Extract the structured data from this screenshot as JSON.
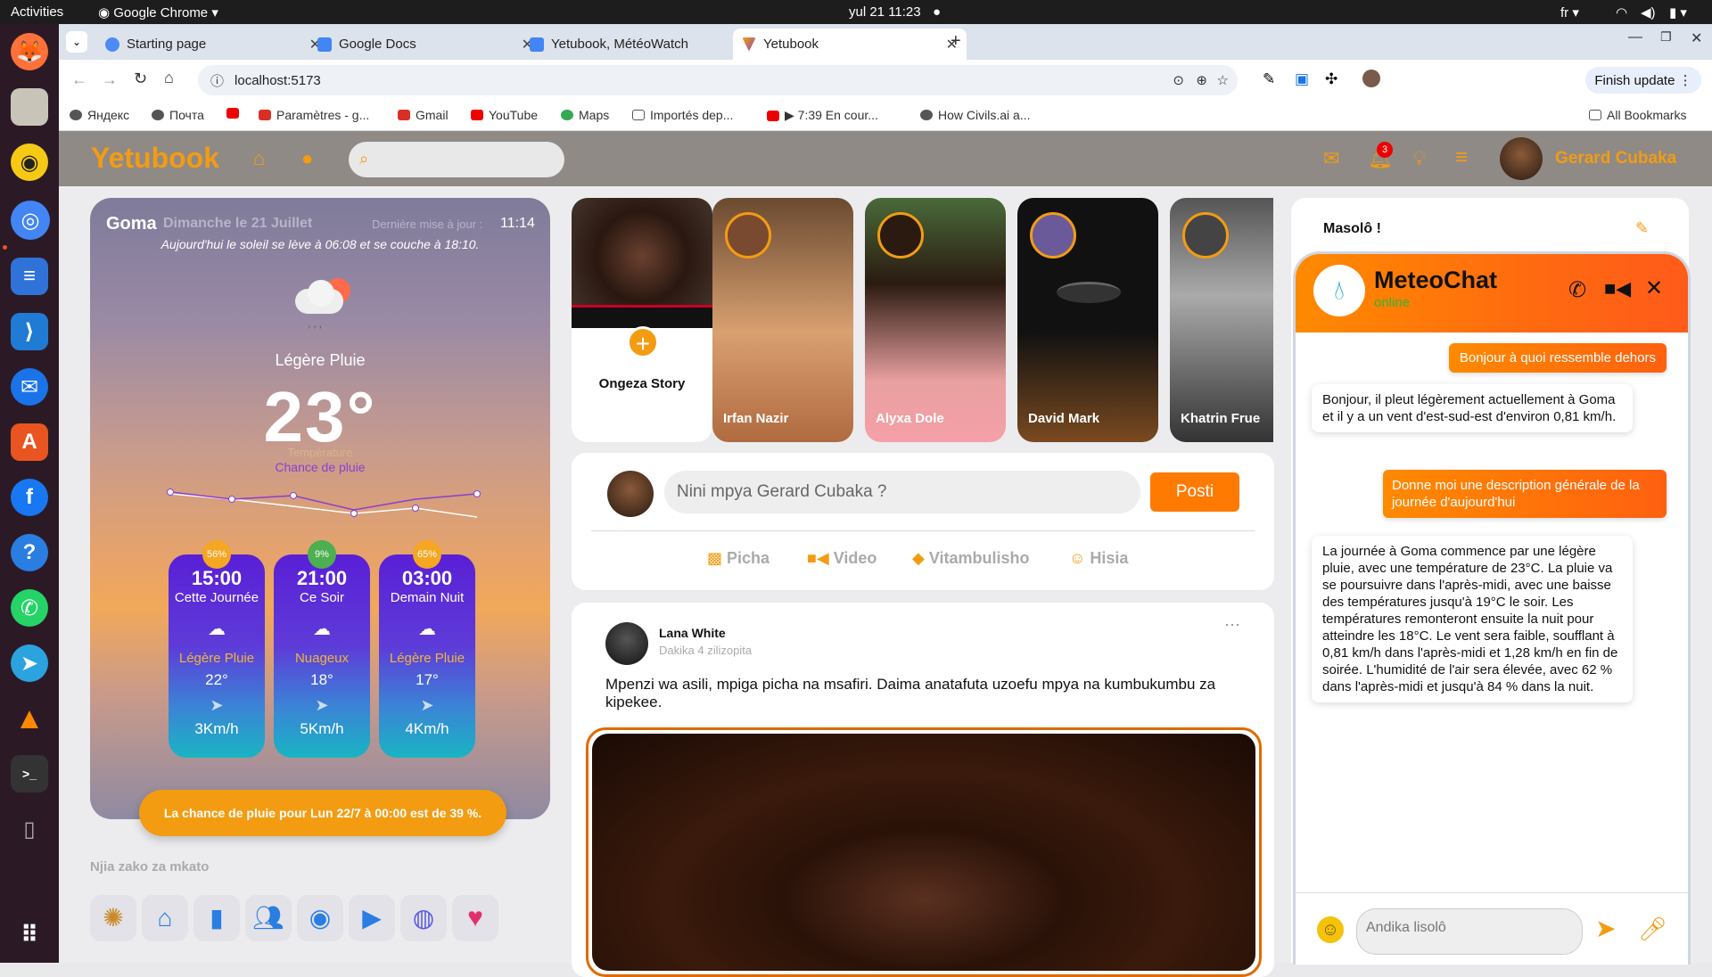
{
  "system": {
    "activities": "Activities",
    "app": "Google Chrome",
    "clock": "yul 21  11:23",
    "lang": "fr"
  },
  "browser": {
    "tabs": [
      {
        "label": "Starting page",
        "color": "#4c8bf5"
      },
      {
        "label": "Google Docs",
        "color": "#4285f4"
      },
      {
        "label": "Yetubook, MétéoWatch",
        "color": "#4285f4"
      },
      {
        "label": "Yetubook",
        "color": "#8e44ad"
      }
    ],
    "url": "localhost:5173",
    "finish_update": "Finish update",
    "bookmarks": [
      {
        "label": "Яндекс",
        "color": "#555"
      },
      {
        "label": "Почта",
        "color": "#555"
      },
      {
        "label": "",
        "color": "#e00"
      },
      {
        "label": "Paramètres - g...",
        "color": "#d93025"
      },
      {
        "label": "Gmail",
        "color": "#d93025"
      },
      {
        "label": "YouTube",
        "color": "#e00"
      },
      {
        "label": "Maps",
        "color": "#34a853"
      },
      {
        "label": "Importés dep...",
        "color": "#666"
      },
      {
        "label": "▶ 7:39 En cour...",
        "color": "#e00"
      },
      {
        "label": "How Civils.ai a...",
        "color": "#555"
      }
    ],
    "all_bookmarks": "All Bookmarks"
  },
  "app": {
    "logo": "Yetubook",
    "notif_count": "3",
    "user_name": "Gerard Cubaka",
    "colors": {
      "accent": "#f39c12",
      "orange": "#ff7a00"
    }
  },
  "weather": {
    "city": "Goma",
    "date": "Dimanche le 21 Juillet",
    "updated_label": "Dernière mise à jour :",
    "updated_time": "11:14",
    "sun_line": "Aujourd'hui le soleil se lève à 06:08 et se couche à 18:10.",
    "condition": "Légère Pluie",
    "temp": "23°",
    "temp_label": "Température",
    "rain_label": "Chance de pluie",
    "forecast": [
      {
        "time": "15:00",
        "label": "Cette Journée",
        "desc": "Légère Pluie",
        "temp": "22°",
        "wind": "3Km/h",
        "rain": "56%",
        "rain_color": "#f5a623"
      },
      {
        "time": "21:00",
        "label": "Ce Soir",
        "desc": "Nuageux",
        "temp": "18°",
        "wind": "5Km/h",
        "rain": "9%",
        "rain_color": "#4caf50"
      },
      {
        "time": "03:00",
        "label": "Demain Nuit",
        "desc": "Légère Pluie",
        "temp": "17°",
        "wind": "4Km/h",
        "rain": "65%",
        "rain_color": "#f5a623"
      }
    ],
    "rain_banner": "La chance de pluie pour Lun 22/7 à 00:00 est de 39 %."
  },
  "shortcuts": {
    "title": "Njia zako za mkato",
    "icons": [
      "brain-icon",
      "store-icon",
      "chart-icon",
      "people-icon",
      "group-icon",
      "video-icon",
      "gamepad-icon",
      "heart-icon"
    ]
  },
  "stories": [
    {
      "name": "Ongeza Story"
    },
    {
      "name": "Irfan Nazir"
    },
    {
      "name": "Alyxa Dole"
    },
    {
      "name": "David Mark"
    },
    {
      "name": "Khatrin Frue"
    }
  ],
  "composer": {
    "placeholder": "Nini mpya Gerard Cubaka ?",
    "post": "Posti",
    "actions": [
      "Picha",
      "Video",
      "Vitambulisho",
      "Hisia"
    ]
  },
  "post": {
    "author": "Lana White",
    "time": "Dakika 4 zilizopita",
    "text": "Mpenzi wa asili, mpiga picha na msafiri. Daima anatafuta uzoefu mpya na kumbukumbu za kipekee."
  },
  "chat": {
    "header": "Masolô !",
    "bot": "MeteoChat",
    "status": "online",
    "messages": [
      {
        "from": "me",
        "text": "Bonjour à quoi ressemble dehors"
      },
      {
        "from": "bot",
        "text": "Bonjour, il pleut légèrement actuellement à Goma et il y a un vent d'est-sud-est d'environ 0,81 km/h."
      },
      {
        "from": "me",
        "text": "Donne moi une description générale de la journée d'aujourd'hui"
      },
      {
        "from": "bot",
        "text": "La journée à Goma commence par une légère pluie, avec une température de 23°C. La pluie va se poursuivre dans l'après-midi, avec une baisse des températures jusqu'à 19°C le soir. Les températures remonteront ensuite la nuit pour atteindre les 18°C. Le vent sera faible, soufflant à 0,81 km/h dans l'après-midi et 1,28 km/h en fin de soirée. L'humidité de l'air sera élevée, avec 62 % dans l'après-midi et jusqu'à 84 % dans la nuit."
      }
    ],
    "input_placeholder": "Andika lisolô"
  }
}
